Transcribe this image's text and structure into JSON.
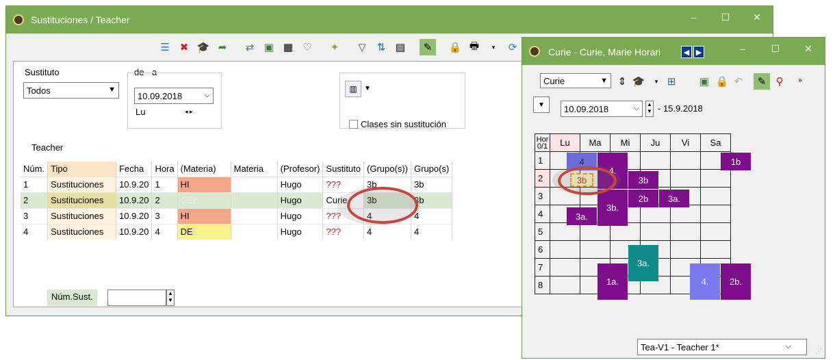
{
  "main_window": {
    "title": "Sustituciones / Teacher",
    "controls": {
      "minimize": "‒",
      "maximize": "☐",
      "close": "✕"
    },
    "filter": {
      "sustituto_label": "Sustituto",
      "sustituto_value": "Todos",
      "range_label": "de - a",
      "date": "10.09.2018",
      "day": "Lu",
      "checkbox_label": "Clases sin sustitución"
    },
    "section_title": "Teacher",
    "columns": [
      "Núm.",
      "Tipo",
      "Fecha",
      "Hora",
      "(Materia)",
      "Materia",
      "(Profesor)",
      "Sustituto",
      "(Grupo(s))",
      "Grupo(s)"
    ],
    "rows": [
      [
        "1",
        "Sustituciones",
        "10.9.20",
        "1",
        "HI",
        "",
        "Hugo",
        "???",
        "3b",
        "3b"
      ],
      [
        "2",
        "Sustituciones",
        "10.9.20",
        "2",
        "GEc",
        "",
        "Hugo",
        "Curie",
        "3b",
        "3b"
      ],
      [
        "3",
        "Sustituciones",
        "10.9.20",
        "3",
        "HI",
        "",
        "Hugo",
        "???",
        "4",
        "4"
      ],
      [
        "4",
        "Sustituciones",
        "10.9.20",
        "4",
        "DE",
        "",
        "Hugo",
        "???",
        "4",
        "4"
      ]
    ],
    "num_sust_label": "Núm.Sust."
  },
  "timetable_window": {
    "title": "Curie - Curie, Marie  Horari",
    "teacher_select": "Curie",
    "date_from": "10.09.2018",
    "date_to": "- 15.9.2018",
    "corner_header": "Hor 0/1",
    "days": [
      "Lu",
      "Ma",
      "Mi",
      "Ju",
      "Vi",
      "Sa"
    ],
    "hours": [
      "1",
      "2",
      "3",
      "4",
      "5",
      "6",
      "7",
      "8"
    ],
    "lessons": {
      "lu1": "4",
      "lu2": "3b",
      "lu4": "3a.",
      "ma1": "4.",
      "ma3": "3b.",
      "ma7": "1a.",
      "mi2": "3b",
      "mi3": "2b",
      "mi6": "3a.",
      "ju3": "3a.",
      "ju7": "4.",
      "vi1": "1b",
      "vi7": "2b."
    },
    "layout_select": "Tea-V1 - Teacher 1*"
  }
}
